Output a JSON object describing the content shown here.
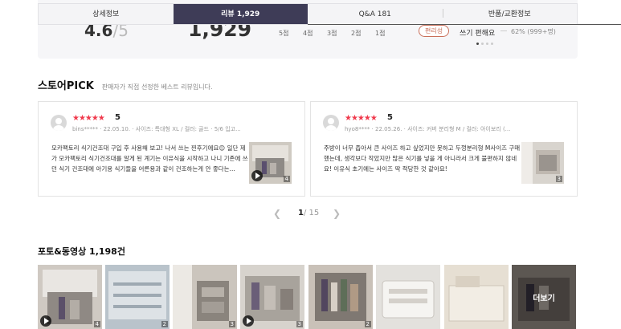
{
  "tabs": [
    {
      "label": "상세정보"
    },
    {
      "label": "리뷰 1,929"
    },
    {
      "label": "Q&A 181"
    },
    {
      "label": "반품/교환정보"
    }
  ],
  "summary": {
    "rating": "4.6",
    "rating_max": "5",
    "review_count": "1,929",
    "star_levels": [
      "5점",
      "4점",
      "3점",
      "2점",
      "1점"
    ],
    "tag_label": "편리성",
    "tag_value": "쓰기 편해요",
    "tag_percent": "62% (999+명)"
  },
  "store_pick": {
    "title": "스토어PICK",
    "subtitle": "판매자가 직접 선정한 베스트 리뷰입니다.",
    "reviews": [
      {
        "stars": "★★★★★",
        "score": "5",
        "user": "bins*****",
        "meta": "22.05.10. · 사이즈: 특대형 XL / 컬러: 골드 · 5/6 입고...",
        "text": "모카팩토리 식기건조대 구입 후 사용해 보고! 나서 쓰는 찐후기에요😊 일단 제가 모카팩토리 식기건조대를 알게 된 계기는 이유식을 시작하고 나니 기존에 쓰던 식기 건조대에 아기용 식기들을 어른용과 같이 건조하는게 안 좋다는...",
        "photo_count": "4"
      },
      {
        "stars": "★★★★★",
        "score": "5",
        "user": "hyo8****",
        "meta": "22.05.26. · 사이즈: 커버 분리형 M / 컬러: 아이보리 (...",
        "text": "주방이 너무 좁아서 큰 사이즈 하고 싶었지만 못하고 두껑분리형 M사이즈 구매했는데, 생각보다 작았지만 많은 식기를 넣을 게 아니라서 크게 불편하지 않네요! 이유식 초기에는 사이즈 딱 적당한 것 같아요!",
        "photo_count": "3"
      }
    ],
    "pager": {
      "current": "1",
      "total": "/ 15"
    }
  },
  "photos": {
    "title_prefix": "포토&동영상",
    "count": "1,198건",
    "counts": [
      "4",
      "2",
      "3",
      "3",
      "2",
      "",
      "",
      ""
    ],
    "more_label": "더보기"
  }
}
